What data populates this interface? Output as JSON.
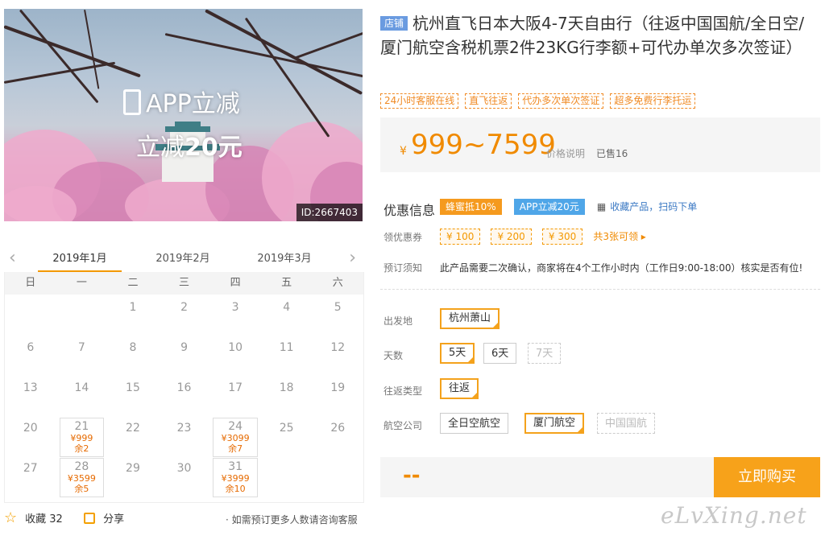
{
  "hero": {
    "app_label": "APP立减",
    "app_sub_prefix": "立减",
    "app_sub_amount": "20元",
    "product_id": "ID:2667403"
  },
  "calendar": {
    "months": [
      "2019年1月",
      "2019年2月",
      "2019年3月"
    ],
    "active_month_index": 0,
    "weekdays": [
      "日",
      "一",
      "二",
      "三",
      "四",
      "五",
      "六"
    ],
    "weeks": [
      [
        {
          "d": ""
        },
        {
          "d": ""
        },
        {
          "d": "1"
        },
        {
          "d": "2"
        },
        {
          "d": "3"
        },
        {
          "d": "4"
        },
        {
          "d": "5"
        }
      ],
      [
        {
          "d": "6"
        },
        {
          "d": "7"
        },
        {
          "d": "8"
        },
        {
          "d": "9"
        },
        {
          "d": "10"
        },
        {
          "d": "11"
        },
        {
          "d": "12"
        }
      ],
      [
        {
          "d": "13"
        },
        {
          "d": "14"
        },
        {
          "d": "15"
        },
        {
          "d": "16"
        },
        {
          "d": "17"
        },
        {
          "d": "18"
        },
        {
          "d": "19"
        }
      ],
      [
        {
          "d": "20"
        },
        {
          "d": "21",
          "price": "¥999",
          "remain": "余2"
        },
        {
          "d": "22"
        },
        {
          "d": "23"
        },
        {
          "d": "24",
          "price": "¥3099",
          "remain": "余7"
        },
        {
          "d": "25"
        },
        {
          "d": "26"
        }
      ],
      [
        {
          "d": "27"
        },
        {
          "d": "28",
          "price": "¥3599",
          "remain": "余5"
        },
        {
          "d": "29"
        },
        {
          "d": "30"
        },
        {
          "d": "31",
          "price": "¥3999",
          "remain": "余10"
        },
        {
          "d": ""
        },
        {
          "d": ""
        }
      ]
    ]
  },
  "footer": {
    "favorite": "收藏 32",
    "share": "分享",
    "consult": "· 如需预订更多人数请咨询客服"
  },
  "product": {
    "store_tag": "店铺",
    "title": "杭州直飞日本大阪4-7天自由行（往返中国国航/全日空/厦门航空含税机票2件23KG行李额+可代办单次多次签证）",
    "tags": [
      "24小时客服在线",
      "直飞往返",
      "代办多次单次签证",
      "超多免费行李托运"
    ],
    "price_currency": "¥",
    "price": "999~7599",
    "price_note": "价格说明",
    "sold": "已售16"
  },
  "offers": {
    "label": "优惠信息",
    "badge1": "蜂蜜抵10%",
    "badge2": "APP立减20元",
    "qr_text": "收藏产品，扫码下单"
  },
  "coupons": {
    "label": "领优惠券",
    "items": [
      "¥ 100",
      "¥ 200",
      "¥ 300"
    ],
    "more": "共3张可领 ▸"
  },
  "booking": {
    "label": "预订须知",
    "text": "此产品需要二次确认，商家将在4个工作小时内（工作日9:00-18:00）核实是否有位!"
  },
  "options": {
    "departure": {
      "label": "出发地",
      "items": [
        "杭州萧山"
      ]
    },
    "days": {
      "label": "天数",
      "items": [
        "5天",
        "6天",
        "7天"
      ]
    },
    "trip_type": {
      "label": "往返类型",
      "items": [
        "往返"
      ]
    },
    "airline": {
      "label": "航空公司",
      "items": [
        "全日空航空",
        "厦门航空",
        "中国国航"
      ]
    }
  },
  "buy": {
    "placeholder": "--",
    "button": "立即购买"
  },
  "watermark": "eLvXing.net",
  "colors": {
    "accent": "#f7a21a",
    "price": "#f08a00",
    "store_tag": "#6a9be0"
  }
}
